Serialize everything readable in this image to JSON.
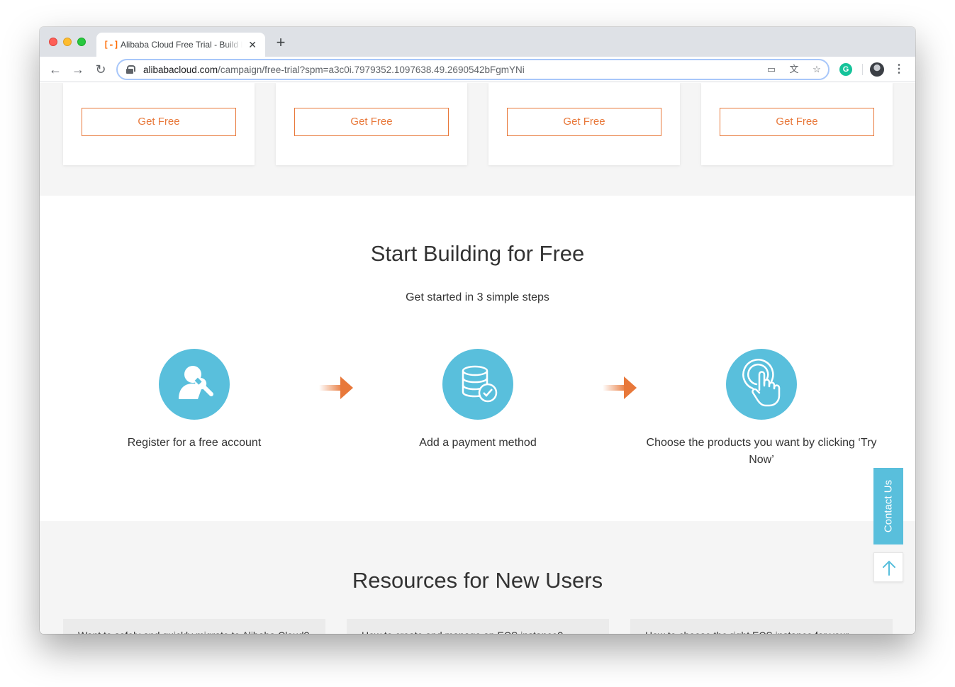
{
  "browser": {
    "tab": {
      "title": "Alibaba Cloud Free Trial - Build B",
      "favicon": "[-]",
      "close_glyph": "✕"
    },
    "new_tab_glyph": "+",
    "nav": {
      "back": "←",
      "forward": "→",
      "reload": "↻"
    },
    "url": {
      "domain": "alibabacloud.com",
      "path": "/campaign/free-trial?spm=a3c0i.7979352.1097638.49.2690542bFgmYNi"
    },
    "omnibox_icons": {
      "cast": "▭",
      "translate": "文",
      "bookmark": "☆"
    },
    "extension_grammarly": "G",
    "menu_glyph": "⋮"
  },
  "cards": [
    {
      "button_label": "Get Free"
    },
    {
      "button_label": "Get Free"
    },
    {
      "button_label": "Get Free"
    },
    {
      "button_label": "Get Free"
    }
  ],
  "steps_section": {
    "title": "Start Building for Free",
    "subtitle": "Get started in 3 simple steps",
    "steps": [
      {
        "label": "Register for a free account",
        "icon": "user-wrench-icon"
      },
      {
        "label": "Add a payment method",
        "icon": "database-check-icon"
      },
      {
        "label": "Choose the products you want by clicking ‘Try Now’",
        "icon": "hand-tap-icon"
      }
    ]
  },
  "resources": {
    "title": "Resources for New Users",
    "items": [
      "Want to safely and quickly migrate to Alibaba Cloud?",
      "How to create and manage an ECS instance?",
      "How to choose the right ECS instance for your"
    ]
  },
  "floating": {
    "contact_us": "Contact Us",
    "back_to_top_icon": "arrow-up-icon"
  },
  "colors": {
    "accent_orange": "#e8783a",
    "accent_blue": "#59bfdc",
    "text": "#333333",
    "section_gray": "#f5f5f5"
  }
}
